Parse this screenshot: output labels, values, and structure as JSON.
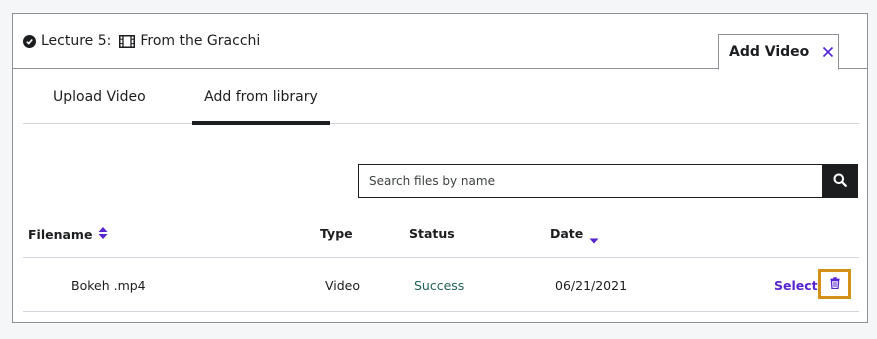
{
  "header": {
    "lecture_label": "Lecture 5:",
    "lecture_title": "From the Gracchi",
    "add_video_tab": "Add Video"
  },
  "tabs": [
    {
      "label": "Upload Video",
      "active": false
    },
    {
      "label": "Add from library",
      "active": true
    }
  ],
  "search": {
    "placeholder": "Search files by name",
    "value": ""
  },
  "table": {
    "columns": [
      "Filename",
      "Type",
      "Status",
      "Date"
    ],
    "rows": [
      {
        "filename": "Bokeh .mp4",
        "type": "Video",
        "status": "Success",
        "date": "06/21/2021",
        "action": "Select"
      }
    ]
  },
  "colors": {
    "accent": "#5624d0",
    "success": "#1e6055",
    "focus_outline": "#d4911a",
    "dark": "#1c1d1f"
  },
  "icons": [
    "check-circle-icon",
    "film-icon",
    "close-icon",
    "search-icon",
    "sort-both-icon",
    "sort-down-icon",
    "trash-icon"
  ]
}
